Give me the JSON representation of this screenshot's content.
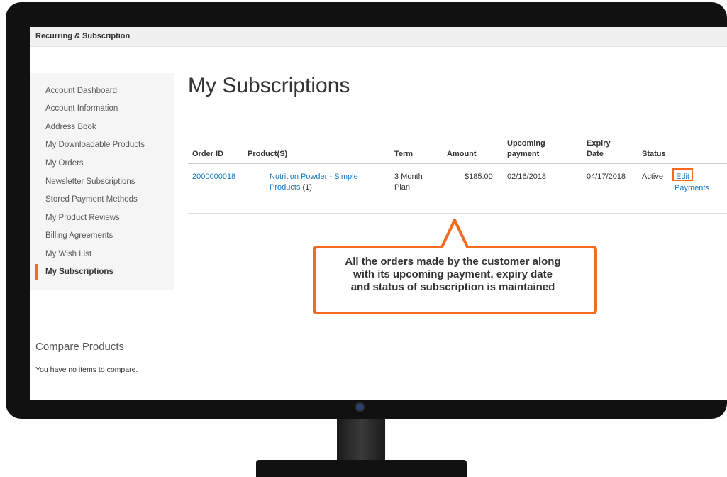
{
  "header": {
    "title": "Recurring & Subscription"
  },
  "sidebar": {
    "items": [
      {
        "label": "Account Dashboard"
      },
      {
        "label": "Account Information"
      },
      {
        "label": "Address Book"
      },
      {
        "label": "My Downloadable Products"
      },
      {
        "label": "My Orders"
      },
      {
        "label": "Newsletter Subscriptions"
      },
      {
        "label": "Stored Payment Methods"
      },
      {
        "label": "My Product Reviews"
      },
      {
        "label": "Billing Agreements"
      },
      {
        "label": "My Wish List"
      },
      {
        "label": "My Subscriptions",
        "active": true
      }
    ]
  },
  "compare": {
    "title": "Compare Products",
    "empty": "You have no items to compare."
  },
  "main": {
    "title": "My Subscriptions",
    "table": {
      "headers": {
        "order_id": "Order ID",
        "products": "Product(S)",
        "term": "Term",
        "amount": "Amount",
        "upcoming_1": "Upcoming",
        "upcoming_2": "payment",
        "expiry_1": "Expiry",
        "expiry_2": "Date",
        "status": "Status"
      },
      "rows": [
        {
          "order_id": "2000000018",
          "product_1": "Nutrition Powder - Simple",
          "product_2": "Products",
          "qty": " (1)",
          "term_1": "3 Month",
          "term_2": "Plan",
          "amount": "$185.00",
          "upcoming": "02/16/2018",
          "expiry": "04/17/2018",
          "status": "Active",
          "edit": "Edit",
          "payments": "Payments"
        }
      ]
    }
  },
  "callout": {
    "line1": "All the orders made by the customer along",
    "line2": "with its upcoming payment, expiry date",
    "line3": "and status of subscription is maintained"
  },
  "colors": {
    "accent": "#f26b21",
    "link": "#1979c3",
    "bezel": "#111111"
  }
}
